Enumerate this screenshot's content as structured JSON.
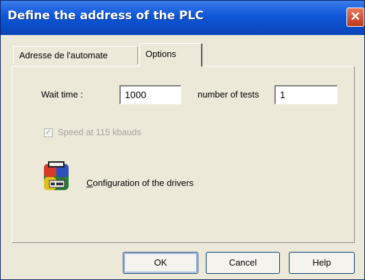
{
  "window": {
    "title": "Define the address of the PLC",
    "close_symbol": "✕"
  },
  "tabs": [
    {
      "label": "Adresse de l'automate",
      "active": false
    },
    {
      "label": "Options",
      "active": true
    }
  ],
  "options": {
    "wait_time_label": "Wait time :",
    "wait_time_value": "1000",
    "number_of_tests_label": "number of tests",
    "number_of_tests_value": "1",
    "speed_checkbox_label": "Speed at 115 kbauds",
    "speed_checked": true,
    "speed_enabled": false,
    "drivers_label_first": "C",
    "drivers_label_rest": "onfiguration of the drivers",
    "drivers_icon": "setup-icon"
  },
  "buttons": {
    "ok": "OK",
    "cancel": "Cancel",
    "help": "Help"
  },
  "colors": {
    "title_bar": "#0e56d8",
    "dialog_bg": "#ece9d8",
    "close_button": "#c0391b"
  }
}
